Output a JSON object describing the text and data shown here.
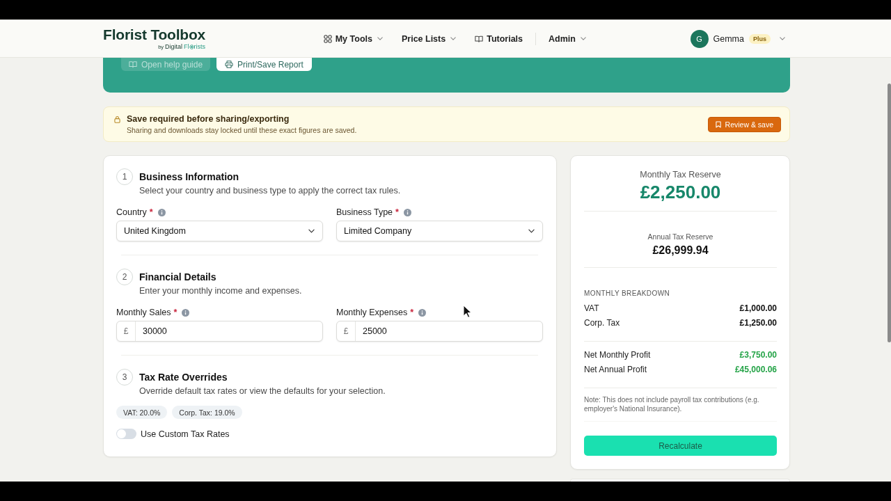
{
  "header": {
    "logo": {
      "title": "Florist Toolbox",
      "by": "by",
      "word": "Digital",
      "brand_start": "Fl",
      "brand_end": "rists"
    },
    "nav": [
      {
        "label": "My Tools",
        "dropdown": true,
        "divider_before": false
      },
      {
        "label": "Price Lists",
        "dropdown": true,
        "divider_before": false
      },
      {
        "label": "Tutorials",
        "dropdown": false,
        "divider_before": false
      },
      {
        "label": "Admin",
        "dropdown": true,
        "divider_before": true
      }
    ],
    "user": {
      "initial": "G",
      "name": "Gemma",
      "plan": "Plus"
    }
  },
  "banner": {
    "buttons": [
      {
        "label": "Open help guide",
        "kind": "ghost"
      },
      {
        "label": "Print/Save Report",
        "kind": "solid"
      }
    ]
  },
  "alert": {
    "title": "Save required before sharing/exporting",
    "message": "Sharing and downloads stay locked until these exact figures are saved.",
    "action": "Review & save"
  },
  "form": {
    "sections": [
      {
        "number": "1",
        "title": "Business Information",
        "description": "Select your country and business type to apply the correct tax rules.",
        "kind": "fields",
        "fields": [
          {
            "label": "Country",
            "required_mark": "*",
            "kind": "select",
            "value": "United Kingdom"
          },
          {
            "label": "Business Type",
            "required_mark": "*",
            "kind": "select",
            "value": "Limited Company"
          }
        ]
      },
      {
        "number": "2",
        "title": "Financial Details",
        "description": "Enter your monthly income and expenses.",
        "kind": "fields",
        "fields": [
          {
            "label": "Monthly Sales",
            "required_mark": "*",
            "kind": "currency",
            "prefix": "£",
            "value": "30000"
          },
          {
            "label": "Monthly Expenses",
            "required_mark": "*",
            "kind": "currency",
            "prefix": "£",
            "value": "25000"
          }
        ]
      },
      {
        "number": "3",
        "title": "Tax Rate Overrides",
        "description": "Override default tax rates or view the defaults for your selection.",
        "kind": "overrides",
        "chips": [
          "VAT: 20.0%",
          "Corp. Tax: 19.0%"
        ],
        "toggle": {
          "label": "Use Custom Tax Rates",
          "on": false
        }
      }
    ]
  },
  "summary": {
    "primary": {
      "label": "Monthly Tax Reserve",
      "value": "£2,250.00"
    },
    "secondary": {
      "label": "Annual Tax Reserve",
      "value": "£26,999.94"
    },
    "breakdown_title": "MONTHLY BREAKDOWN",
    "breakdown": [
      {
        "label": "VAT",
        "value": "£1,000.00"
      },
      {
        "label": "Corp. Tax",
        "value": "£1,250.00"
      }
    ],
    "profits": [
      {
        "label": "Net Monthly Profit",
        "value": "£3,750.00"
      },
      {
        "label": "Net Annual Profit",
        "value": "£45,000.06"
      }
    ],
    "note": "Note: This does not include payroll tax contributions (e.g. employer's National Insurance).",
    "button": "Recalculate"
  }
}
